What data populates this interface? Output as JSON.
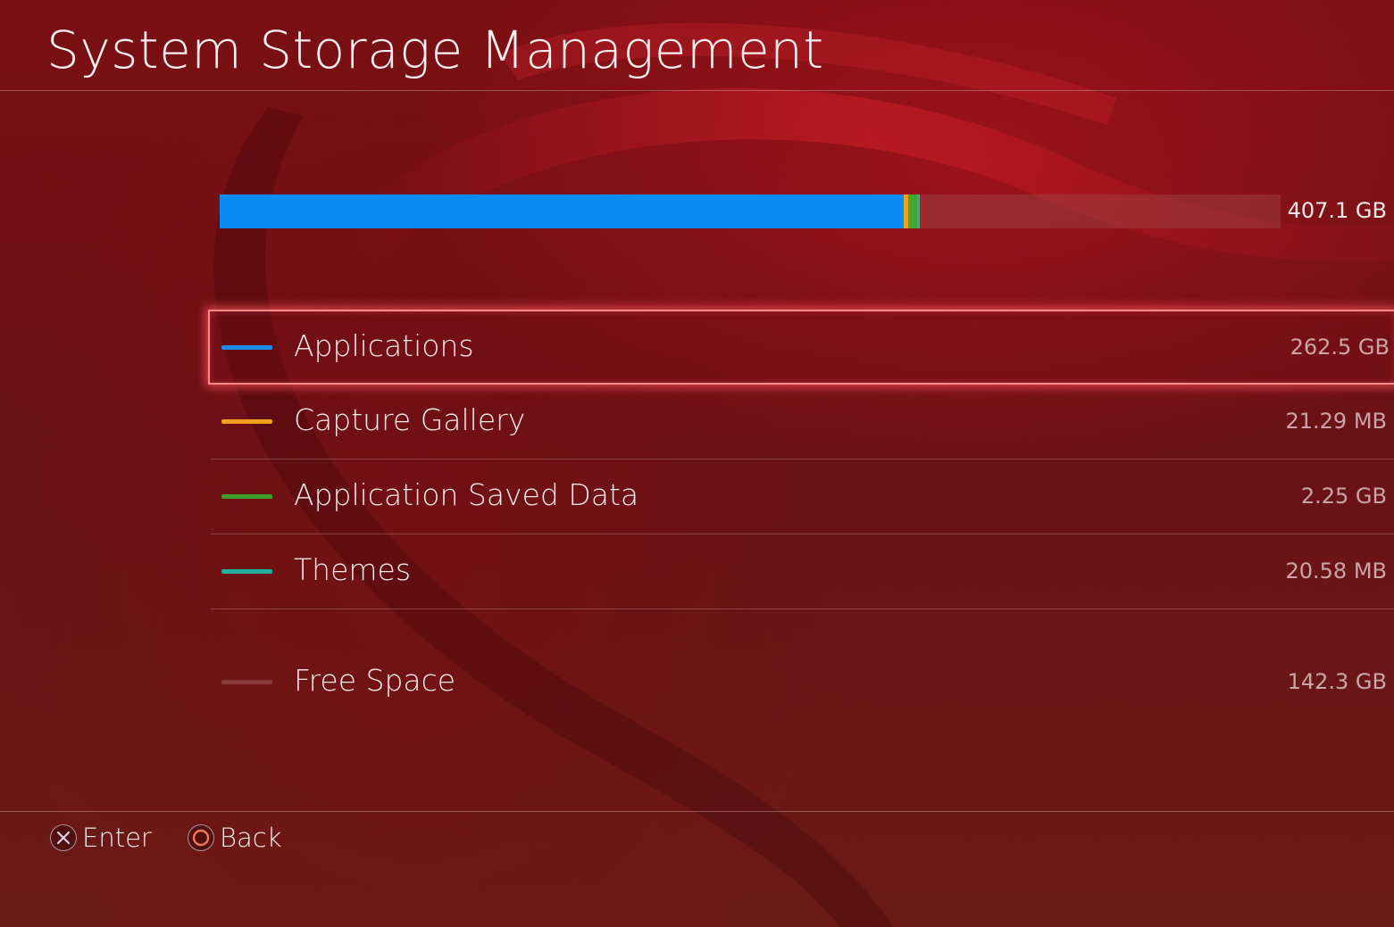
{
  "page": {
    "title": "System Storage Management"
  },
  "storage_bar": {
    "total_label": "407.1 GB",
    "fractions": [
      {
        "key": "applications",
        "value": 0.6448,
        "color": "#0a8cf5"
      },
      {
        "key": "capture",
        "value": 0.004,
        "color": "#f4a41b"
      },
      {
        "key": "saved",
        "value": 0.0085,
        "color": "#3fa82d"
      },
      {
        "key": "themes",
        "value": 0.002,
        "color": "#24b4a0"
      }
    ]
  },
  "categories": [
    {
      "label": "Applications",
      "size": "262.5 GB",
      "color": "#1a8de8",
      "selected": true
    },
    {
      "label": "Capture Gallery",
      "size": "21.29 MB",
      "color": "#f2a020"
    },
    {
      "label": "Application Saved Data",
      "size": "2.25 GB",
      "color": "#3da02c"
    },
    {
      "label": "Themes",
      "size": "20.58 MB",
      "color": "#22b0a0"
    },
    {
      "label": "Free Space",
      "size": "142.3 GB",
      "color": "#8a3a3a"
    }
  ],
  "footer": {
    "enter_label": "Enter",
    "back_label": "Back",
    "enter_icon": "cross-button-icon",
    "back_icon": "circle-button-icon"
  }
}
